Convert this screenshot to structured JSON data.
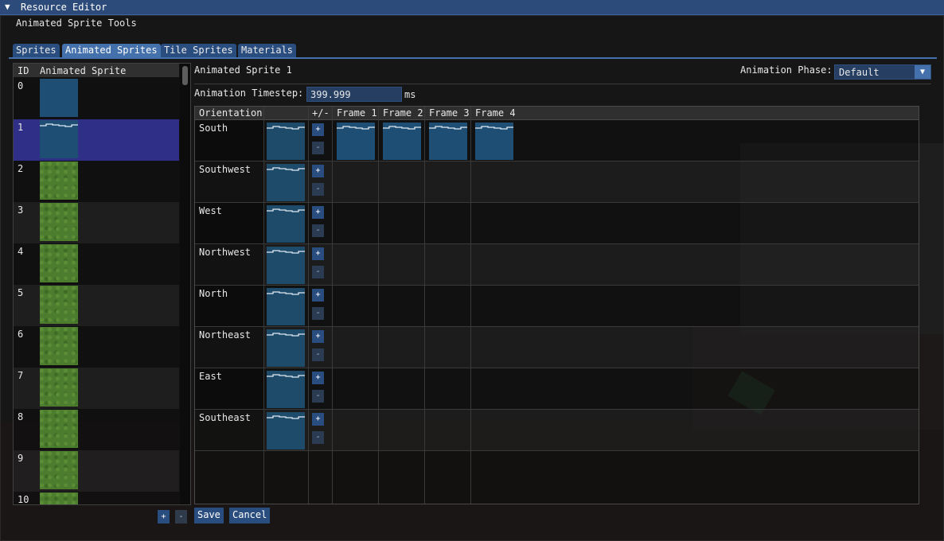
{
  "window": {
    "title": "Resource Editor",
    "collapse_glyph": "▼"
  },
  "section_label": "Animated Sprite Tools",
  "tabs": [
    {
      "label": "Sprites",
      "active": false
    },
    {
      "label": "Animated Sprites",
      "active": true
    },
    {
      "label": "Tile Sprites",
      "active": false
    },
    {
      "label": "Materials",
      "active": false
    }
  ],
  "sprite_list": {
    "headers": {
      "id": "ID",
      "name": "Animated Sprite"
    },
    "selected_id": "1",
    "items": [
      {
        "id": "0",
        "kind": "water"
      },
      {
        "id": "1",
        "kind": "water-animated"
      },
      {
        "id": "2",
        "kind": "grass"
      },
      {
        "id": "3",
        "kind": "grass"
      },
      {
        "id": "4",
        "kind": "grass"
      },
      {
        "id": "5",
        "kind": "grass"
      },
      {
        "id": "6",
        "kind": "grass"
      },
      {
        "id": "7",
        "kind": "grass"
      },
      {
        "id": "8",
        "kind": "grass"
      },
      {
        "id": "9",
        "kind": "grass"
      },
      {
        "id": "10",
        "kind": "grass"
      }
    ],
    "add_label": "+",
    "remove_label": "-"
  },
  "editor": {
    "sprite_name": "Animated Sprite 1",
    "phase_label": "Animation Phase:",
    "phase_value": "Default",
    "phase_arrow": "▼",
    "timestep_label": "Animation Timestep:",
    "timestep_value": "399.999",
    "timestep_unit": "ms",
    "columns": {
      "orientation": "Orientation",
      "preview": "",
      "plusminus": "+/-",
      "frames": [
        "Frame 1",
        "Frame 2",
        "Frame 3",
        "Frame 4"
      ]
    },
    "rows": [
      {
        "orientation": "South",
        "frame_count": 4
      },
      {
        "orientation": "Southwest",
        "frame_count": 0
      },
      {
        "orientation": "West",
        "frame_count": 0
      },
      {
        "orientation": "Northwest",
        "frame_count": 0
      },
      {
        "orientation": "North",
        "frame_count": 0
      },
      {
        "orientation": "Northeast",
        "frame_count": 0
      },
      {
        "orientation": "East",
        "frame_count": 0
      },
      {
        "orientation": "Southeast",
        "frame_count": 0
      }
    ],
    "row_add_label": "+",
    "row_remove_label": "-",
    "save_label": "Save",
    "cancel_label": "Cancel"
  },
  "colors": {
    "accent": "#4471ac",
    "tab": "#2a4d7f",
    "selected_row": "#302f88",
    "water": "#1e4e73",
    "grass": "#4c7d2e"
  }
}
